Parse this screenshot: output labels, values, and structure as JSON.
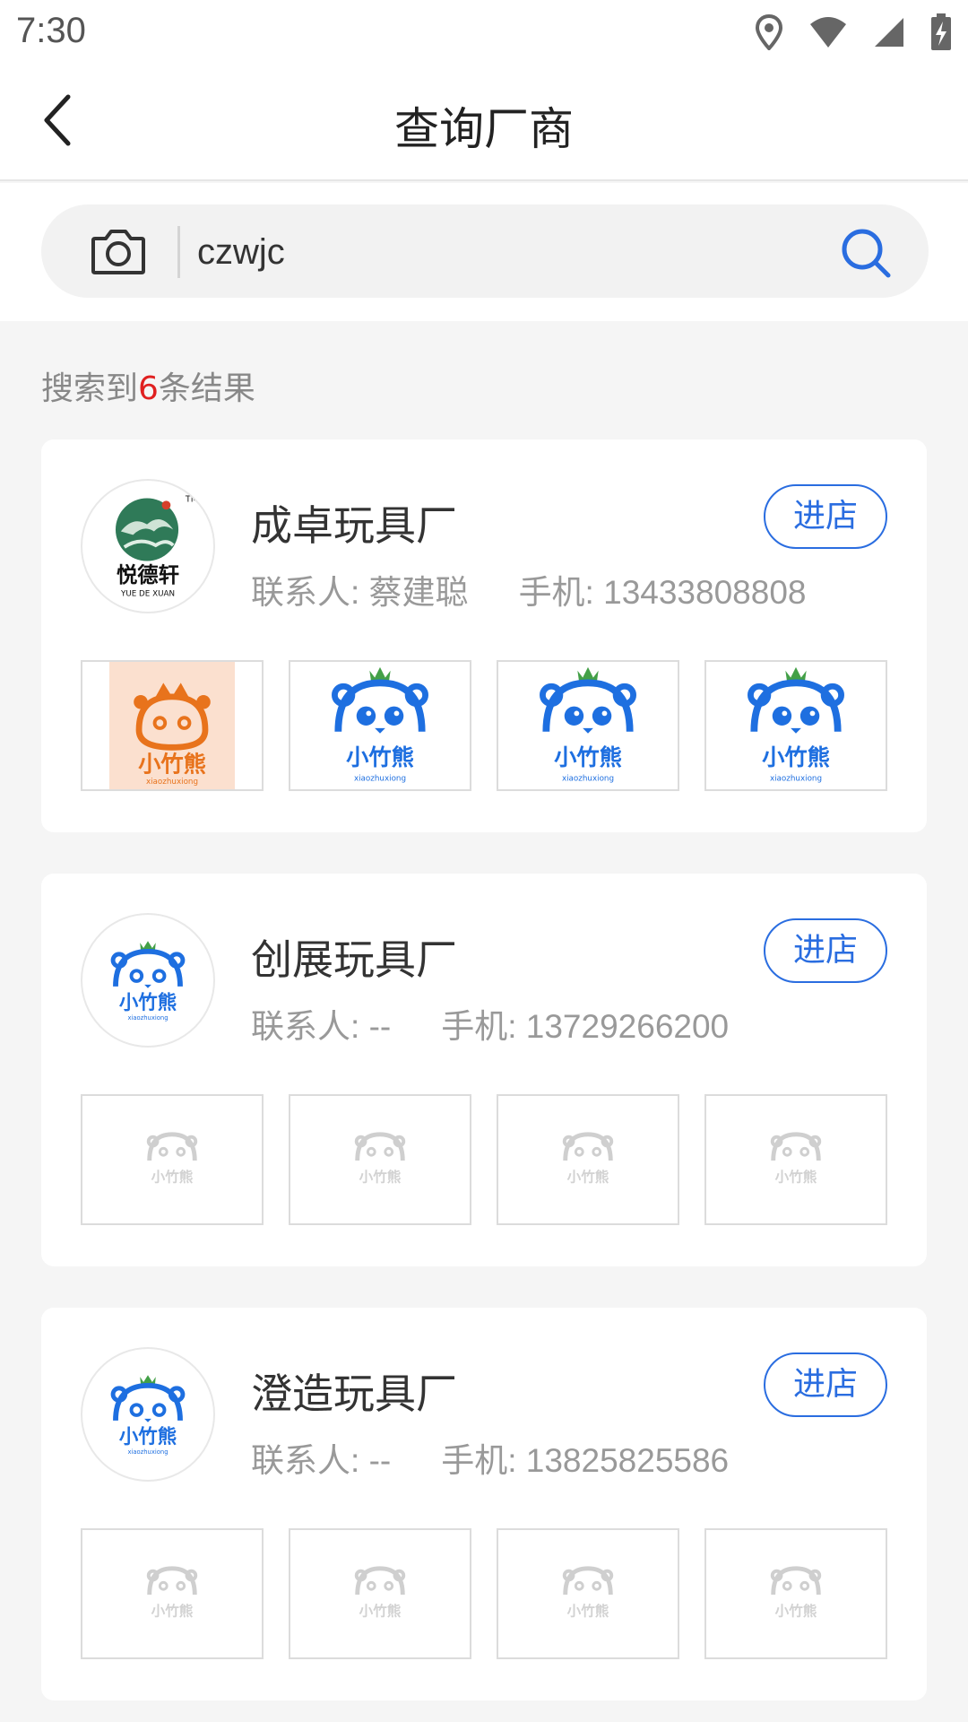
{
  "status_bar": {
    "time": "7:30"
  },
  "header": {
    "title": "查询厂商"
  },
  "search": {
    "query": "czwjc"
  },
  "results": {
    "prefix": "搜索到",
    "count": "6",
    "suffix": "条结果"
  },
  "vendors": [
    {
      "name": "成卓玩具厂",
      "contact_label": "联系人:",
      "contact": "蔡建聪",
      "phone_label": "手机:",
      "phone": "13433808808",
      "enter_label": "进店",
      "logo": "yuedexuan-logo",
      "logo_text": "悦德轩",
      "logo_subtext": "YUE DE XUAN",
      "thumbnails": [
        "xiaozhuxiong-orange",
        "xiaozhuxiong-blue",
        "xiaozhuxiong-blue",
        "xiaozhuxiong-blue"
      ]
    },
    {
      "name": "创展玩具厂",
      "contact_label": "联系人:",
      "contact": "--",
      "phone_label": "手机:",
      "phone": "13729266200",
      "enter_label": "进店",
      "logo": "xiaozhuxiong-logo",
      "thumbnails": [
        "placeholder",
        "placeholder",
        "placeholder",
        "placeholder"
      ]
    },
    {
      "name": "澄造玩具厂",
      "contact_label": "联系人:",
      "contact": "--",
      "phone_label": "手机:",
      "phone": "13825825586",
      "enter_label": "进店",
      "logo": "xiaozhuxiong-logo",
      "thumbnails": [
        "placeholder",
        "placeholder",
        "placeholder",
        "placeholder"
      ]
    }
  ],
  "brand_text": {
    "cn": "小竹熊",
    "en": "xiaozhuxiong"
  },
  "colors": {
    "accent": "#2a6de0",
    "count": "#e02020",
    "orange": "#e8731c"
  }
}
